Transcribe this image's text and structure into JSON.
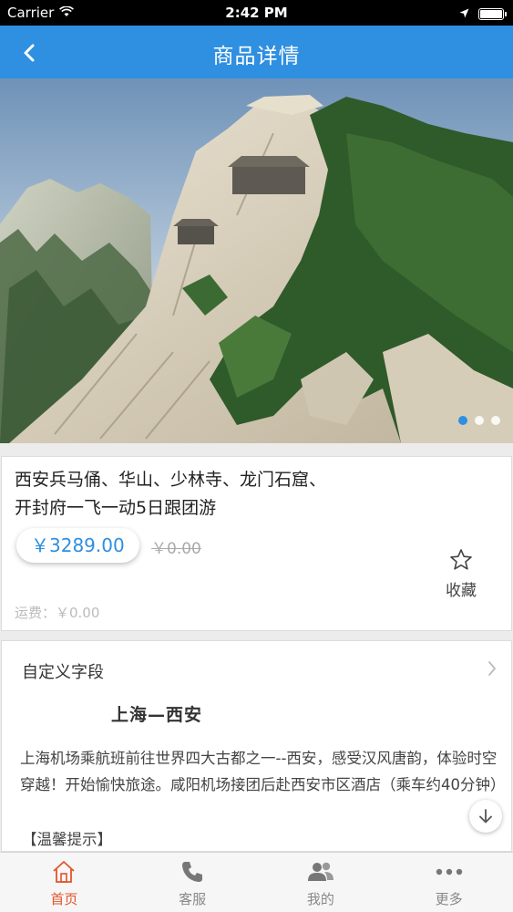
{
  "status": {
    "carrier": "Carrier",
    "time": "2:42 PM"
  },
  "nav": {
    "title": "商品详情"
  },
  "hero": {
    "slide_count": 3,
    "active_slide": 1
  },
  "product": {
    "title_line1": "西安兵马俑、华山、少林寺、龙门石窟、",
    "title_line2": "开封府一飞一动5日跟团游",
    "price": "￥3289.00",
    "original_price": "￥0.00",
    "favorite_label": "收藏",
    "shipping": "运费：￥0.00"
  },
  "custom_field": {
    "header": "自定义字段",
    "route_title": "上海—西安",
    "description": "上海机场乘航班前往世界四大古都之一--西安，感受汉风唐韵，体验时空穿越！开始愉快旅途。咸阳机场接团后赴西安市区酒店（乘车约40分钟）",
    "tip": "【温馨提示】"
  },
  "tabs": [
    {
      "label": "首页",
      "icon": "home-icon",
      "active": true
    },
    {
      "label": "客服",
      "icon": "phone-icon",
      "active": false
    },
    {
      "label": "我的",
      "icon": "users-icon",
      "active": false
    },
    {
      "label": "更多",
      "icon": "more-icon",
      "active": false
    }
  ],
  "colors": {
    "accent": "#2f8fe0",
    "tab_active": "#e2542c"
  }
}
